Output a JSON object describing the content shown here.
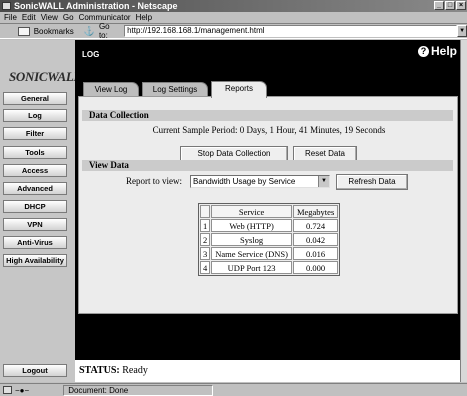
{
  "window": {
    "title": "SonicWALL Administration - Netscape"
  },
  "menu": [
    "File",
    "Edit",
    "View",
    "Go",
    "Communicator",
    "Help"
  ],
  "location": {
    "bookmarks_label": "Bookmarks",
    "goto_label": "Go to:",
    "url": "http://192.168.168.1/management.html"
  },
  "sidebar": {
    "logo": "SONICWALL",
    "items": [
      "General",
      "Log",
      "Filter",
      "Tools",
      "Access",
      "Advanced",
      "DHCP",
      "VPN",
      "Anti-Virus",
      "High Availability"
    ],
    "logout": "Logout"
  },
  "header": {
    "section": "LOG",
    "help": "Help"
  },
  "tabs": [
    "View Log",
    "Log Settings",
    "Reports"
  ],
  "data_collection": {
    "heading": "Data Collection",
    "sample_period": "Current Sample Period: 0 Days, 1 Hour, 41 Minutes, 19 Seconds",
    "stop_button": "Stop Data Collection",
    "reset_button": "Reset Data"
  },
  "view_data": {
    "heading": "View Data",
    "report_label": "Report to view:",
    "report_selected": "Bandwidth Usage by Service",
    "refresh_button": "Refresh Data"
  },
  "table": {
    "headers": [
      "Service",
      "Megabytes"
    ],
    "rows": [
      {
        "idx": "1",
        "service": "Web (HTTP)",
        "mb": "0.724"
      },
      {
        "idx": "2",
        "service": "Syslog",
        "mb": "0.042"
      },
      {
        "idx": "3",
        "service": "Name Service (DNS)",
        "mb": "0.016"
      },
      {
        "idx": "4",
        "service": "UDP Port 123",
        "mb": "0.000"
      }
    ]
  },
  "status": {
    "label": "STATUS:",
    "text": "Ready"
  },
  "statusbar": {
    "text": "Document: Done"
  }
}
